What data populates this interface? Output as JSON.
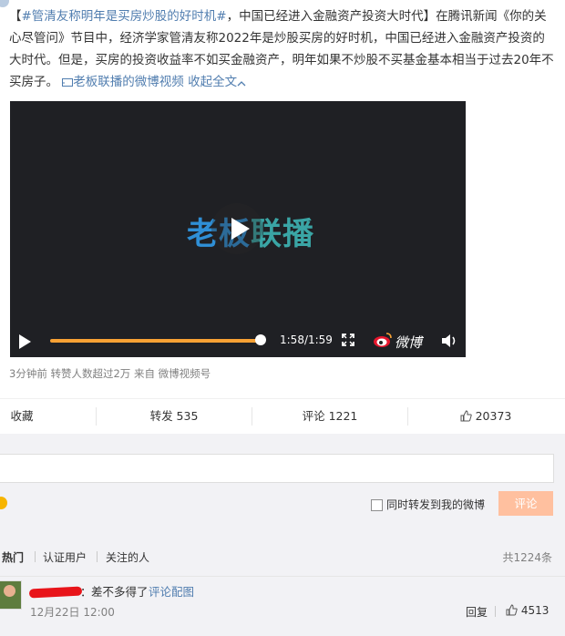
{
  "post": {
    "bracket_open": "【",
    "topic": "#管清友称明年是买房炒股的好时机#",
    "headline": "，中国已经进入金融资产投资大时代",
    "bracket_close": "】",
    "body": "在腾讯新闻《你的关心尽管问》节目中，经济学家管清友称2022年是炒股买房的好时机，中国已经进入金融资产投资的大时代。但是，买房的投资收益率不如买金融资产，明年如果不炒股不买基金基本相当于过去20年不买房子。",
    "video_link": "老板联播的微博视频",
    "collapse_link": "收起全文",
    "meta": "3分钟前 转赞人数超过2万  来自 微博视频号"
  },
  "video": {
    "logo_text_1": "老板",
    "logo_text_2": "联播",
    "progress": 0.99,
    "time": "1:58/1:59",
    "weibo_label": "微博"
  },
  "actions": {
    "favorite": "收藏",
    "repost": "转发 535",
    "comment": "评论 1221",
    "like": "20373"
  },
  "composer": {
    "placeholder": "",
    "also_repost": "同时转发到我的微博",
    "submit": "评论"
  },
  "comment_tabs": {
    "hot": "热门",
    "verified": "认证用户",
    "following": "关注的人",
    "total": "共1224条"
  },
  "comments": [
    {
      "text": "差不多得了",
      "link": "评论配图",
      "time": "12月22日 12:00",
      "reply": "回复",
      "likes": "4513"
    }
  ],
  "colors": {
    "topic": "#eb7350",
    "link": "#507daf",
    "progress": "#f7a134",
    "submit_disabled": "#ffc09f"
  }
}
